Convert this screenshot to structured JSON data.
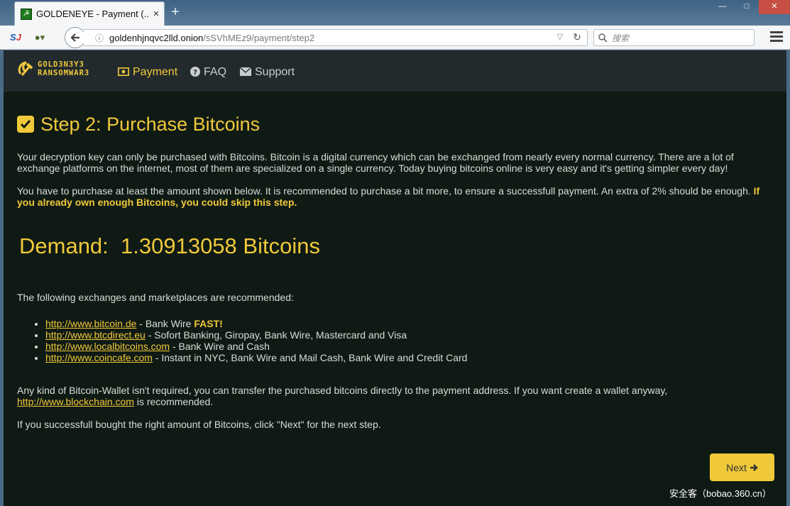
{
  "browser": {
    "tab_title": "GOLDENEYE - Payment (...",
    "tab_close": "×",
    "new_tab": "+",
    "url_host": "goldenhjnqvc2lld.onion",
    "url_path": "/sSVhMEz9/payment/step2",
    "search_placeholder": "搜索"
  },
  "site": {
    "logo_line1": "GOLD3N3Y3",
    "logo_line2": "RANSOMWAR3",
    "nav": {
      "payment": "Payment",
      "faq": "FAQ",
      "support": "Support"
    }
  },
  "content": {
    "heading": "Step 2: Purchase Bitcoins",
    "intro": "Your decryption key can only be purchased with Bitcoins. Bitcoin is a digital currency which can be exchanged from nearly every normal currency. There are a lot of exchange platforms on the internet, most of them are specialized on a single currency. Today buying bitcoins online is very easy and it's getting simpler every day!",
    "purchase_note": "You have to purchase at least the amount shown below. It is recommended to purchase a bit more, to ensure a successfull payment. An extra of 2% should be enough.",
    "skip_note": "If you already own enough Bitcoins, you could skip this step.",
    "demand": "Demand:  1.30913058 Bitcoins",
    "exchanges_intro": "The following exchanges and marketplaces are recommended:",
    "exchanges": [
      {
        "url": "http://www.bitcoin.de",
        "desc": " - Bank Wire ",
        "extra": "FAST!"
      },
      {
        "url": "http://www.btcdirect.eu",
        "desc": " - Sofort Banking, Giropay, Bank Wire, Mastercard and Visa",
        "extra": ""
      },
      {
        "url": "http://www.localbitcoins.com",
        "desc": " - Bank Wire and Cash",
        "extra": ""
      },
      {
        "url": "http://www.coincafe.com",
        "desc": " - Instant in NYC, Bank Wire and Mail Cash, Bank Wire and Credit Card",
        "extra": ""
      }
    ],
    "wallet_note": "Any kind of Bitcoin-Wallet isn't required, you can transfer the purchased bitcoins directly to the payment address. If you want create a wallet anyway,",
    "wallet_link": "http://www.blockchain.com",
    "wallet_suffix": " is recommended.",
    "next_hint": "If you successfull bought the right amount of Bitcoins, click \"Next\" for the next step.",
    "next_button": "Next"
  },
  "watermark": "安全客（bobao.360.cn）",
  "colors": {
    "accent": "#f0c93a",
    "page_bg": "#101a14",
    "nav_bg": "#222a2d"
  }
}
